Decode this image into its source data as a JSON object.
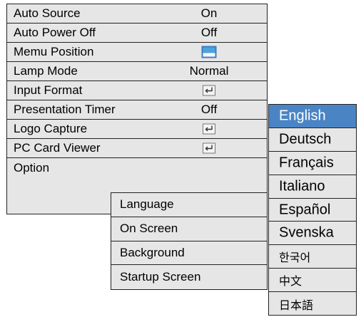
{
  "main_menu": {
    "items": [
      {
        "label": "Auto Source",
        "value": "On"
      },
      {
        "label": "Auto Power Off",
        "value": "Off"
      },
      {
        "label": "Memu Position",
        "value": "",
        "icon": "menu-position-icon"
      },
      {
        "label": "Lamp Mode",
        "value": "Normal"
      },
      {
        "label": "Input Format",
        "value": "",
        "icon": "enter-icon"
      },
      {
        "label": "Presentation Timer",
        "value": "Off"
      },
      {
        "label": "Logo Capture",
        "value": "",
        "icon": "enter-icon"
      },
      {
        "label": "PC Card Viewer",
        "value": "",
        "icon": "enter-icon"
      },
      {
        "label": "Option",
        "value": ""
      }
    ]
  },
  "option_menu": {
    "items": [
      {
        "label": "Language"
      },
      {
        "label": "On Screen"
      },
      {
        "label": "Background"
      },
      {
        "label": "Startup Screen"
      }
    ]
  },
  "language_menu": {
    "selected": "English",
    "items": [
      {
        "label": "English"
      },
      {
        "label": "Deutsch"
      },
      {
        "label": "Français"
      },
      {
        "label": "Italiano"
      },
      {
        "label": "Español"
      },
      {
        "label": "Svenska"
      },
      {
        "label": "한국어"
      },
      {
        "label": "中文"
      },
      {
        "label": "日本語"
      }
    ]
  },
  "colors": {
    "menu_background": "#e6e6e6",
    "selection": "#4a84c5",
    "border": "#222222"
  }
}
